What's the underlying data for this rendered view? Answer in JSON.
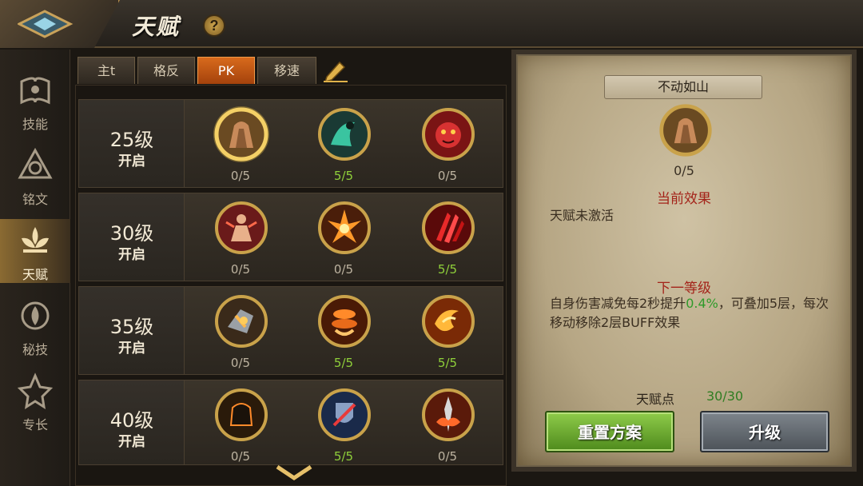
{
  "header": {
    "title": "天赋",
    "help_label": "?"
  },
  "sidebar": {
    "items": [
      {
        "label": "技能",
        "icon": "skill-book-icon"
      },
      {
        "label": "铭文",
        "icon": "inscription-icon"
      },
      {
        "label": "天赋",
        "icon": "talent-lotus-icon",
        "active": true
      },
      {
        "label": "秘技",
        "icon": "secret-skill-icon"
      },
      {
        "label": "专长",
        "icon": "specialty-icon"
      }
    ]
  },
  "tabs": [
    {
      "label": "主t"
    },
    {
      "label": "格反"
    },
    {
      "label": "PK",
      "active": true
    },
    {
      "label": "移速"
    }
  ],
  "rows": [
    {
      "level": "25级",
      "open": "开启",
      "slots": [
        {
          "count": "0/5",
          "icon": "rock-talent-icon",
          "selected": true
        },
        {
          "count": "5/5",
          "icon": "shadow-figure-icon"
        },
        {
          "count": "0/5",
          "icon": "beast-face-icon"
        }
      ]
    },
    {
      "level": "30级",
      "open": "开启",
      "slots": [
        {
          "count": "0/5",
          "icon": "warrior-rage-icon"
        },
        {
          "count": "0/5",
          "icon": "fire-burst-icon"
        },
        {
          "count": "5/5",
          "icon": "blood-claw-icon"
        }
      ]
    },
    {
      "level": "35级",
      "open": "开启",
      "slots": [
        {
          "count": "0/5",
          "icon": "armor-shatter-icon"
        },
        {
          "count": "5/5",
          "icon": "flame-vortex-icon"
        },
        {
          "count": "5/5",
          "icon": "lightning-swirl-icon"
        }
      ]
    },
    {
      "level": "40级",
      "open": "开启",
      "slots": [
        {
          "count": "0/5",
          "icon": "dark-fist-icon"
        },
        {
          "count": "5/5",
          "icon": "shield-strike-icon"
        },
        {
          "count": "0/5",
          "icon": "spear-fire-icon"
        }
      ]
    }
  ],
  "detail": {
    "name": "不动如山",
    "count": "0/5",
    "current_title": "当前效果",
    "current_text": "天赋未激活",
    "next_title": "下一等级",
    "next_text_a": "自身伤害减免每2秒提升",
    "next_text_hl": "0.4%",
    "next_text_b": "，可叠加5层，每次移动移除2层BUFF效果",
    "points_label": "天赋点",
    "points_value": "30/30",
    "reset_label": "重置方案",
    "upgrade_label": "升级"
  },
  "colors": {
    "accent": "#d86a1c",
    "full": "#8fd03a",
    "red_title": "#a4241a"
  }
}
